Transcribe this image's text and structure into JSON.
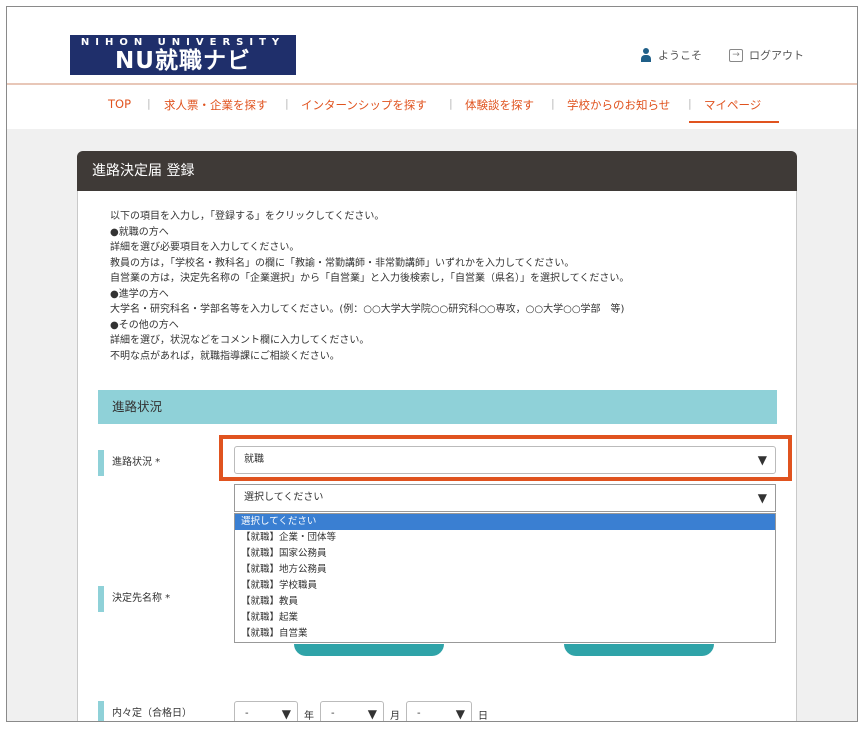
{
  "header": {
    "logo_small": "NIHON UNIVERSITY",
    "logo_main": "NU就職ナビ",
    "welcome": "ようこそ",
    "logout": "ログアウト"
  },
  "nav": [
    "TOP",
    "求人票・企業を探す",
    "インターンシップを探す",
    "体験談を探す",
    "学校からのお知らせ",
    "マイページ"
  ],
  "nav_active": "マイページ",
  "card": {
    "title": "進路決定届 登録",
    "intro": [
      "以下の項目を入力し，「登録する」をクリックしてください。",
      "●就職の方へ",
      "詳細を選び必要項目を入力してください。",
      "教員の方は，「学校名・教科名」の欄に「教諭・常勤講師・非常勤講師」いずれかを入力してください。",
      "自営業の方は，決定先名称の「企業選択」から「自営業」と入力後検索し，「自営業（県名）」を選択してください。",
      "●進学の方へ",
      "大学名・研究科名・学部名等を入力してください。(例：○○大学大学院○○研究科○○専攻，○○大学○○学部　等)",
      "●その他の方へ",
      "詳細を選び，状況などをコメント欄に入力してください。",
      "不明な点があれば，就職指導課にご相談ください。"
    ],
    "section_title": "進路状況"
  },
  "form": {
    "status_label": "進路状況 *",
    "status_value": "就職",
    "detail_value": "選択してください",
    "detail_options": [
      "選択してください",
      "【就職】企業・団体等",
      "【就職】国家公務員",
      "【就職】地方公務員",
      "【就職】学校職員",
      "【就職】教員",
      "【就職】起業",
      "【就職】自営業"
    ],
    "destination_label": "決定先名称 *",
    "offer_label": "内々定（合格日）",
    "date_year": "-",
    "date_month": "-",
    "date_day": "-",
    "year_unit": "年",
    "month_unit": "月",
    "day_unit": "日"
  },
  "colors": {
    "accent": "#e0531f",
    "teal": "#8fd1d8",
    "title_bar": "#3f3a37",
    "logo_bg": "#1f2f6b",
    "selected_option": "#3a7fd2"
  },
  "icons": [
    "person-icon",
    "logout-icon",
    "dropdown-arrow-icon"
  ]
}
